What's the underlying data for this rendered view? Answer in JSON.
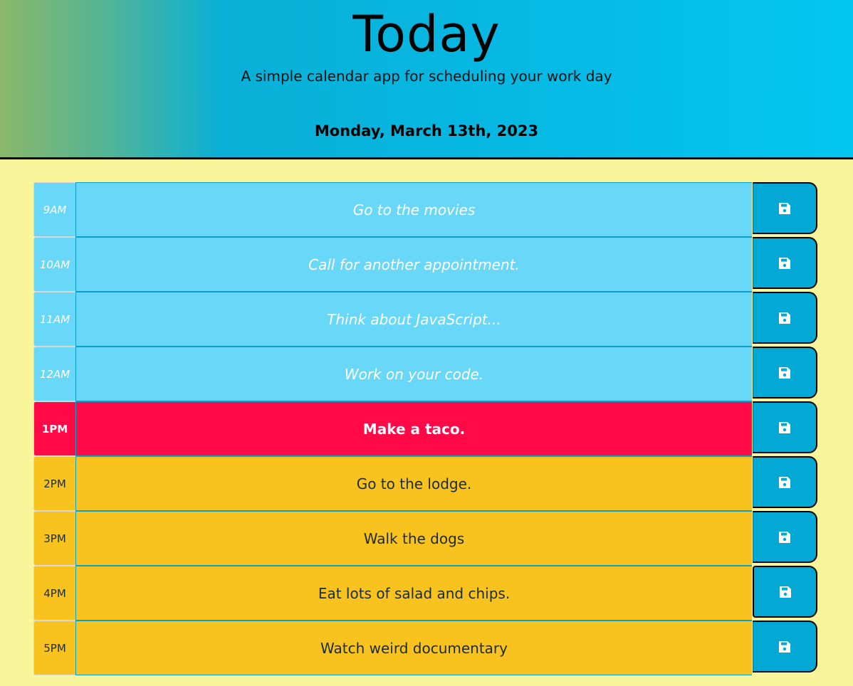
{
  "header": {
    "title": "Today",
    "subtitle": "A simple calendar app for scheduling your work day",
    "current_date": "Monday, March 13th, 2023"
  },
  "colors": {
    "past": "#69d7f8",
    "present": "#ff0a47",
    "future": "#f9c31f",
    "save_button": "#03a9d4",
    "page_background": "#f9f59a"
  },
  "schedule": [
    {
      "hour": "9AM",
      "text": "Go to the movies",
      "state": "past",
      "icon": "save-icon"
    },
    {
      "hour": "10AM",
      "text": "Call for another appointment.",
      "state": "past",
      "icon": "save-icon"
    },
    {
      "hour": "11AM",
      "text": "Think about JavaScript...",
      "state": "past",
      "icon": "save-icon"
    },
    {
      "hour": "12AM",
      "text": "Work on your code.",
      "state": "past",
      "icon": "save-icon"
    },
    {
      "hour": "1PM",
      "text": "Make a taco.",
      "state": "present",
      "icon": "save-icon"
    },
    {
      "hour": "2PM",
      "text": "Go to the lodge.",
      "state": "future",
      "icon": "save-icon"
    },
    {
      "hour": "3PM",
      "text": "Walk the dogs",
      "state": "future",
      "icon": "save-icon"
    },
    {
      "hour": "4PM",
      "text": "Eat lots of salad and chips.",
      "state": "future",
      "icon": "save-icon"
    },
    {
      "hour": "5PM",
      "text": "Watch weird documentary",
      "state": "future",
      "icon": "save-icon"
    }
  ]
}
